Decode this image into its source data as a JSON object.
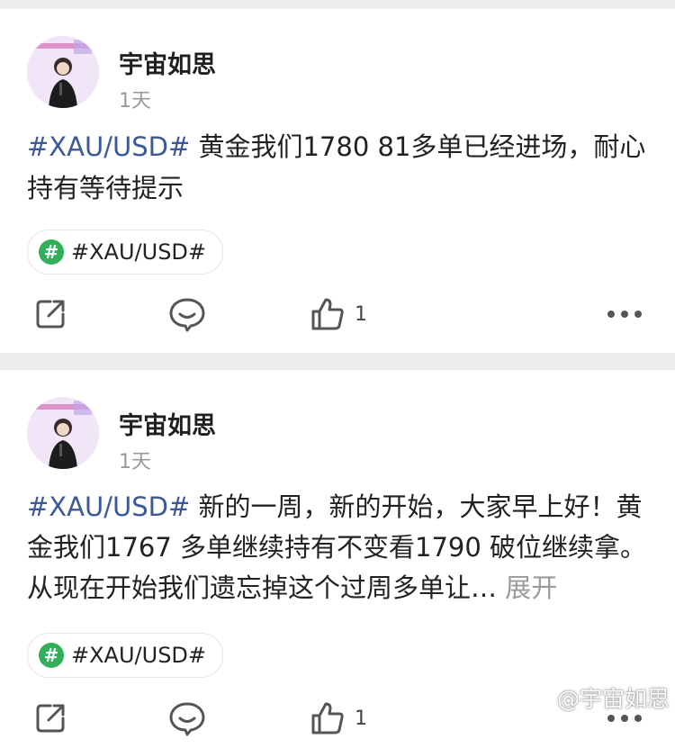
{
  "posts": [
    {
      "author": "宇宙如思",
      "time": "1天",
      "hashtag": "#XAU/USD#",
      "body": " 黄金我们1780 81多单已经进场，耐心持有等待提示",
      "expand": "",
      "topic": "#XAU/USD#",
      "topic_icon": "#",
      "likes": "1"
    },
    {
      "author": "宇宙如思",
      "time": "1天",
      "hashtag": "#XAU/USD#",
      "body": " 新的一周，新的开始，大家早上好！黄金我们1767 多单继续持有不变看1790 破位继续拿。从现在开始我们遗忘掉这个过周多单让…",
      "expand": " 展开",
      "topic": "#XAU/USD#",
      "topic_icon": "#",
      "likes": "1"
    }
  ],
  "watermark": "@宇宙如思",
  "colors": {
    "accent": "#3b5998",
    "topic_green": "#31b05a",
    "muted": "#9a9a9a"
  }
}
